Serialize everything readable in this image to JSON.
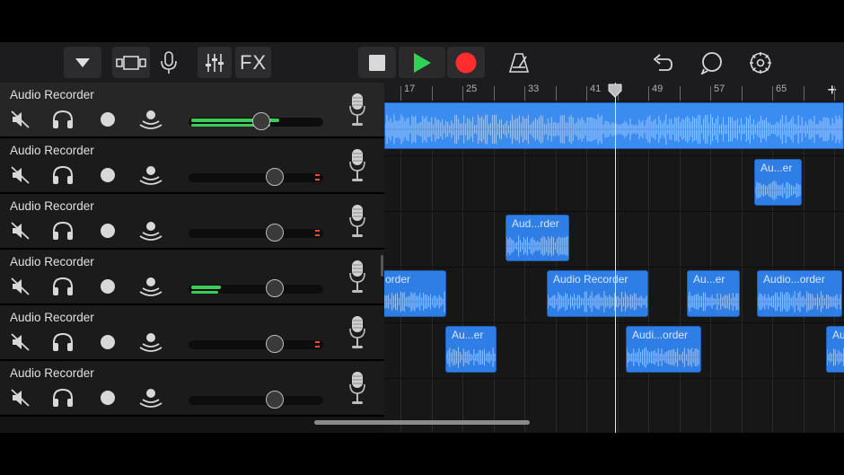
{
  "toolbar": {
    "fx_label": "FX",
    "buttons": [
      "tracks-dropdown",
      "view-toggle",
      "instrument-mic",
      "mixer",
      "fx",
      "stop",
      "play",
      "record",
      "metronome",
      "undo",
      "loop-browser",
      "settings"
    ]
  },
  "colors": {
    "play_green": "#2fd158",
    "record_red": "#ff2d2d",
    "region_blue": "#2f7ee5",
    "volume_green": "#3ccc59"
  },
  "ruler": {
    "labels": [
      "17",
      "25",
      "33",
      "41",
      "49",
      "57",
      "65"
    ],
    "add_label": "+"
  },
  "tracks": [
    {
      "name": "Audio Recorder",
      "volume": 0.56,
      "meter": 0.65,
      "peak": false,
      "selected": true
    },
    {
      "name": "Audio Recorder",
      "volume": 0.68,
      "meter": 0,
      "peak": true,
      "selected": false
    },
    {
      "name": "Audio Recorder",
      "volume": 0.68,
      "meter": 0,
      "peak": true,
      "selected": false
    },
    {
      "name": "Audio Recorder",
      "volume": 0.68,
      "meter": 0.22,
      "peak": false,
      "selected": false
    },
    {
      "name": "Audio Recorder",
      "volume": 0.68,
      "meter": 0,
      "peak": true,
      "selected": false
    },
    {
      "name": "Audio Recorder",
      "volume": 0.68,
      "meter": 0,
      "peak": false,
      "selected": false
    }
  ],
  "regions": [
    {
      "lane": 0,
      "label": ""
    },
    {
      "lane": 1,
      "label": "Au...er"
    },
    {
      "lane": 2,
      "label": "Aud...rder"
    },
    {
      "lane": 3,
      "label": "order"
    },
    {
      "lane": 3,
      "label": "Audio Recorder"
    },
    {
      "lane": 3,
      "label": "Au...er"
    },
    {
      "lane": 3,
      "label": "Audio...order"
    },
    {
      "lane": 4,
      "label": "Au...er"
    },
    {
      "lane": 4,
      "label": "Audi...order"
    },
    {
      "lane": 4,
      "label": "Au"
    }
  ]
}
